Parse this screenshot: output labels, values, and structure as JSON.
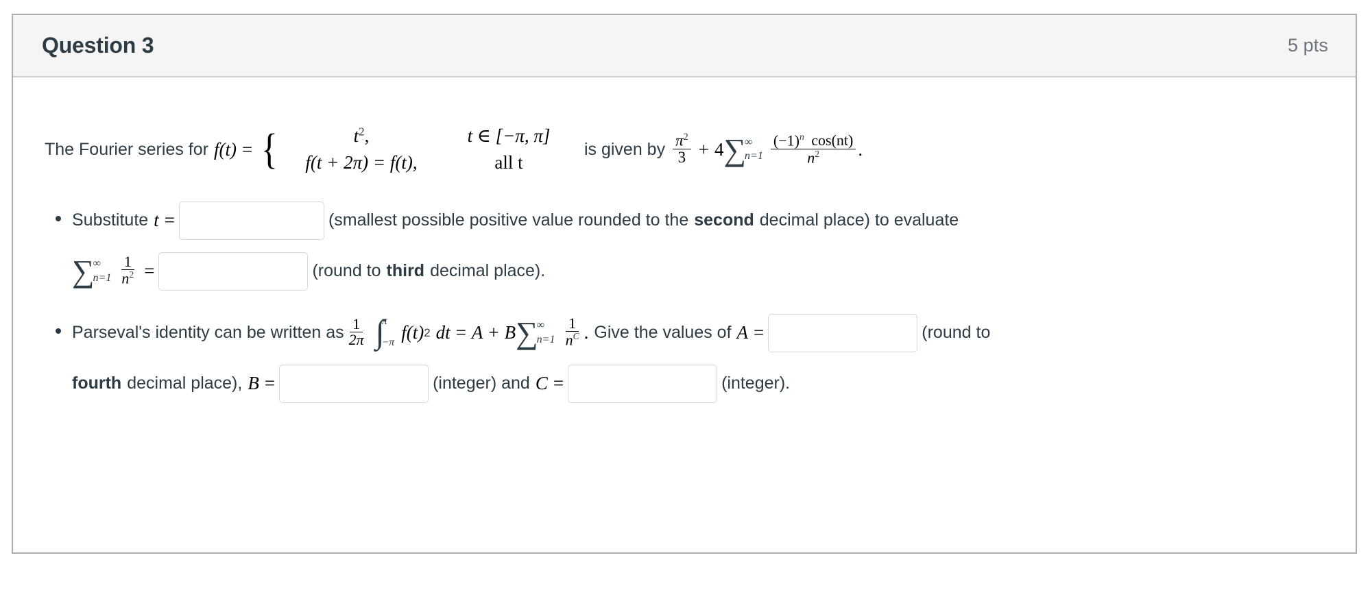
{
  "question": {
    "title": "Question 3",
    "points": "5 pts"
  },
  "intro": {
    "lead_text": "The Fourier series for",
    "fn": "f(t)",
    "equals": "=",
    "case_value_1": "t",
    "case_value_1_exp": "2",
    "case_value_1_comma": ",",
    "case_cond_1": "t ∈ [−π, π]",
    "case_value_2": "f(t + 2π) = f(t),",
    "case_cond_2": "all t",
    "given_by_text": "is given by",
    "series_frac_num": "π",
    "series_frac_num_exp": "2",
    "series_frac_den": "3",
    "plus": "+",
    "coefficient": "4",
    "sum_symbol": "∑",
    "sum_upper": "∞",
    "sum_lower": "n=1",
    "term_num_base": "(−1)",
    "term_num_exp": "n",
    "term_num_cos": "cos(nt)",
    "term_den": "n",
    "term_den_exp": "2",
    "period": "."
  },
  "bullet1": {
    "text_before": "Substitute",
    "var_t": "t",
    "eq": "=",
    "input_t_value": "",
    "input_t_placeholder": "",
    "text_after_a": "(smallest possible positive value rounded to the",
    "bold_word": "second",
    "text_after_b": "decimal place) to evaluate",
    "sum_symbol": "∑",
    "sum_upper": "∞",
    "sum_lower": "n=1",
    "frac_num": "1",
    "frac_den": "n",
    "frac_den_exp": "2",
    "eq2": "=",
    "input_sum_value": "",
    "input_sum_placeholder": "",
    "round_text_a": "(round to",
    "round_bold": "third",
    "round_text_b": "decimal place)."
  },
  "bullet2": {
    "text_before": "Parseval's identity can be written as",
    "coef_num": "1",
    "coef_den": "2π",
    "int_symbol": "∫",
    "int_upper": "π",
    "int_lower": "−π",
    "integrand": "f(t)",
    "integrand_exp": "2",
    "dt": "dt",
    "eq": "=",
    "A": "A",
    "plus": "+",
    "B": "B",
    "sum_symbol": "∑",
    "sum_upper": "∞",
    "sum_lower": "n=1",
    "frac_num": "1",
    "frac_den": "n",
    "frac_den_exp": "C",
    "period": ".",
    "give_values_text": "Give the values of",
    "A_label": "A",
    "A_eq": "=",
    "input_A_value": "",
    "input_A_placeholder": "",
    "round_text_a": "(round to",
    "round_bold": "fourth",
    "round_text_b": "decimal place),",
    "B_label": "B",
    "B_eq": "=",
    "input_B_value": "",
    "input_B_placeholder": "",
    "integer_text_1": "(integer) and",
    "C_label": "C",
    "C_eq": "=",
    "input_C_value": "",
    "input_C_placeholder": "",
    "integer_text_2": "(integer)."
  },
  "colors": {
    "card_border": "#aaadb0",
    "header_bg": "#f5f5f5",
    "text": "#2d3b45",
    "points_text": "#6d7278",
    "input_border": "#d6d9dc"
  }
}
